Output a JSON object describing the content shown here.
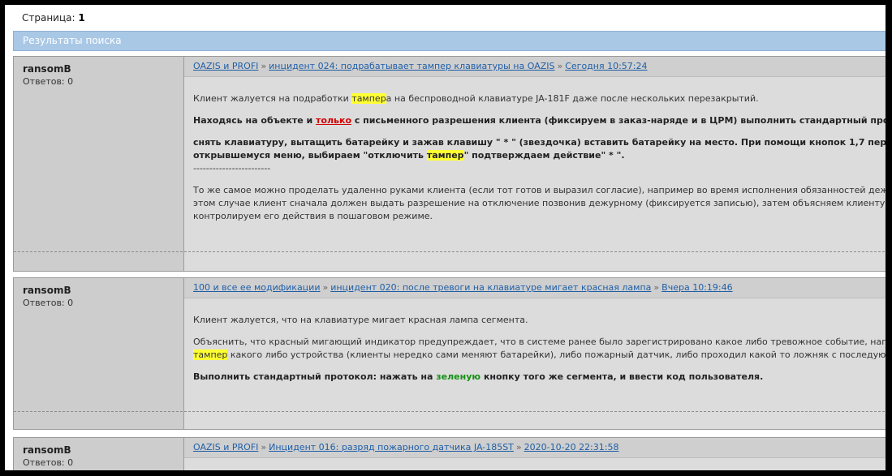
{
  "page": {
    "label": "Страница:",
    "number": "1"
  },
  "results_title": "Результаты поиска",
  "posts": [
    {
      "author": "ransomB",
      "replies": "Ответов: 0",
      "forum": "OAZIS и PROFI",
      "topic": "инцидент 024: подрабатывает тампер клавиатуры на OAZIS",
      "date": "Сегодня 10:57:24",
      "para1": {
        "a": "Клиент жалуется на подработки ",
        "hl": "тампер",
        "b": "а на беспроводной клавиатуре JA-181F даже после нескольких перезакрытий."
      },
      "para2": {
        "a": "Находясь на объекте и ",
        "link": "только",
        "b": " с письменного разрешения клиента (фиксируем в заказ-наряде и в ЦРМ) выполнить стандартный протокол:"
      },
      "para3": {
        "line1": "снять клавиатуру, вытащить батарейку и зажав клавишу \" * \" (звездочка) вставить батарейку на место. При помощи кнопок 1,7 перейти к пункту",
        "line2a": "открывшемуся меню, выбираем \"отключить ",
        "hl": "тампер",
        "line2b": "\" подтверждаем действие\" * \"."
      },
      "divider": "------------------------",
      "para4": {
        "line1": "То же самое можно проделать удаленно руками клиента (если тот готов и выразил согласие), например во время исполнения обязанностей дежурным. В",
        "line2": "этом случае клиент сначала должен выдать разрешение на отключение позвонив дежурному (фиксируется записью), затем объясняем клиенту задачу и",
        "line3": "контролируем его действия в пошаговом режиме."
      }
    },
    {
      "author": "ransomB",
      "replies": "Ответов: 0",
      "forum": "100 и все ее модификации",
      "topic": "инцидент 020: после тревоги на клавиатуре мигает красная лампа",
      "date": "Вчера 10:19:46",
      "para1": "Клиент жалуется, что на клавиатуре мигает красная лампа сегмента.",
      "para2": {
        "line1": "Объяснить, что красный мигающий индикатор предупреждает, что в системе ранее было зарегистрировано какое либо тревожное событие, например сработал",
        "hl": "тампер",
        "line2": " какого либо устройства (клиенты нередко сами меняют батарейки), либо пожарный датчик, либо проходил какой то ложняк с последующим сбросом."
      },
      "para3": {
        "a": "Выполнить стандартный протокол: нажать на ",
        "green": "зеленую",
        "b": " кнопку того же сегмента, и ввести код пользователя."
      }
    },
    {
      "author": "ransomB",
      "replies": "Ответов: 0",
      "forum": "OAZIS и PROFI",
      "topic": "Инцидент 016: разряд пожарного датчика JA-185ST",
      "date": "2020-10-20 22:31:58"
    }
  ]
}
